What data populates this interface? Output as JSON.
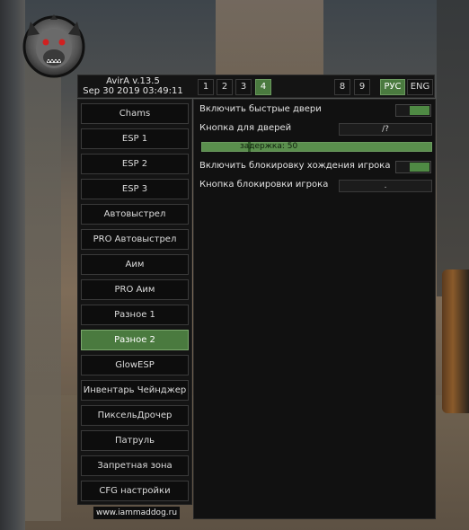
{
  "header": {
    "version": "AvirA v.13.5",
    "datetime": "Sep 30 2019  03:49:11",
    "tabs": [
      {
        "label": "1",
        "active": false
      },
      {
        "label": "2",
        "active": false
      },
      {
        "label": "3",
        "active": false
      },
      {
        "label": "4",
        "active": true
      },
      {
        "label": "8",
        "active": false
      },
      {
        "label": "9",
        "active": false
      }
    ],
    "languages": [
      {
        "label": "РУС",
        "active": true
      },
      {
        "label": "ENG",
        "active": false
      }
    ]
  },
  "sidebar": {
    "items": [
      {
        "label": "Chams"
      },
      {
        "label": "ESP 1"
      },
      {
        "label": "ESP 2"
      },
      {
        "label": "ESP 3"
      },
      {
        "label": "Автовыстрел"
      },
      {
        "label": "PRO Автовыстрел"
      },
      {
        "label": "Аим"
      },
      {
        "label": "PRO Аим"
      },
      {
        "label": "Разное 1"
      },
      {
        "label": "Разное 2",
        "active": true
      },
      {
        "label": "GlowESP"
      },
      {
        "label": "Инвентарь Чейнджер"
      },
      {
        "label": "ПиксельДрочер"
      },
      {
        "label": "Патруль"
      },
      {
        "label": "Запретная зона"
      },
      {
        "label": "CFG настройки"
      }
    ]
  },
  "footer": {
    "site": "www.iammaddog.ru"
  },
  "panel": {
    "fast_doors": {
      "label": "Включить быстрые двери",
      "enabled": true
    },
    "door_key": {
      "label": "Кнопка для дверей",
      "value": "/?"
    },
    "delay": {
      "label": "задержка: 50",
      "value": 50
    },
    "block_walk": {
      "label": "Включить блокировку хождения игрока",
      "enabled": true
    },
    "block_key": {
      "label": "Кнопка блокировки игрока",
      "value": "."
    }
  },
  "colors": {
    "accent": "#4a7a3f",
    "panel_bg": "#111111"
  }
}
